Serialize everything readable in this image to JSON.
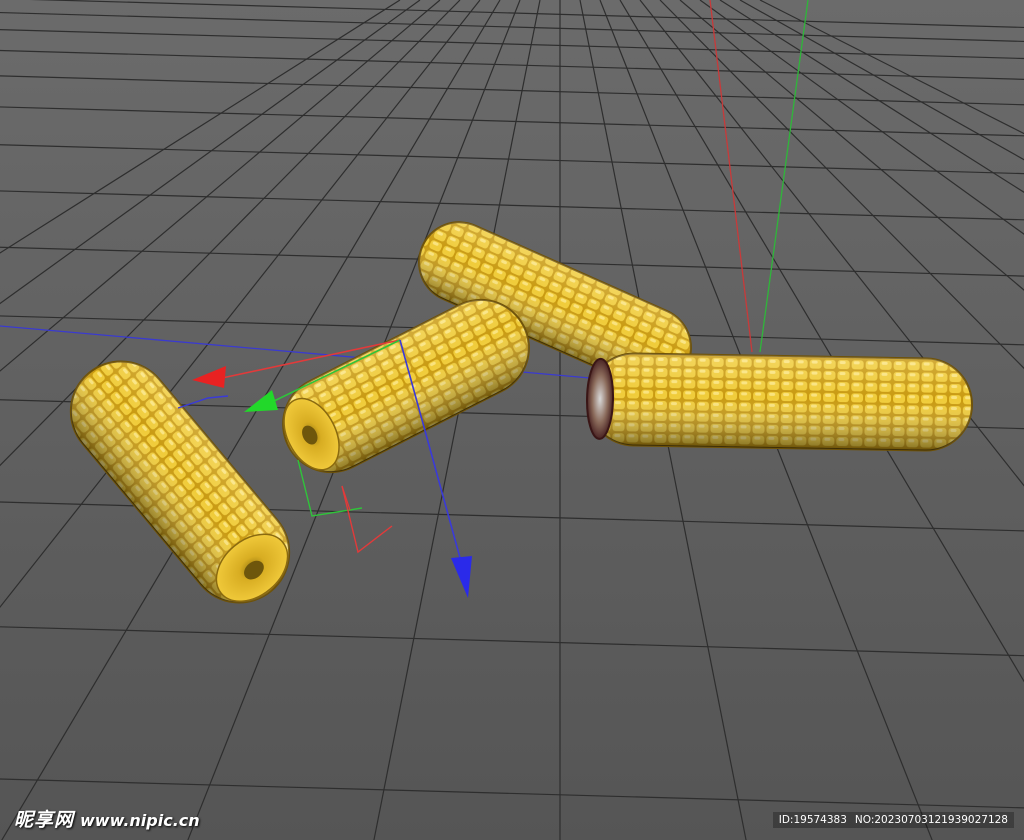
{
  "viewport": {
    "background_color": "#5e5e5e",
    "grid_color": "#2e2e2e",
    "axes": {
      "x_color": "#e23a3a",
      "y_color": "#2fc43a",
      "z_color": "#3a3ad8"
    }
  },
  "objects": [
    {
      "name": "corn-cob",
      "color": "#e3b92a",
      "state": "unselected"
    },
    {
      "name": "corn-cob",
      "color": "#e3b92a",
      "state": "selected"
    },
    {
      "name": "corn-cob",
      "color": "#e3b92a",
      "state": "unselected"
    },
    {
      "name": "corn-cob",
      "color": "#e3b92a",
      "state": "unselected",
      "note_visible": "cut end"
    }
  ],
  "watermark": {
    "site_name": "昵享网",
    "site_url": "www.nipic.cn",
    "id_text": "ID:19574383",
    "no_text": "NO:20230703121939027128"
  }
}
